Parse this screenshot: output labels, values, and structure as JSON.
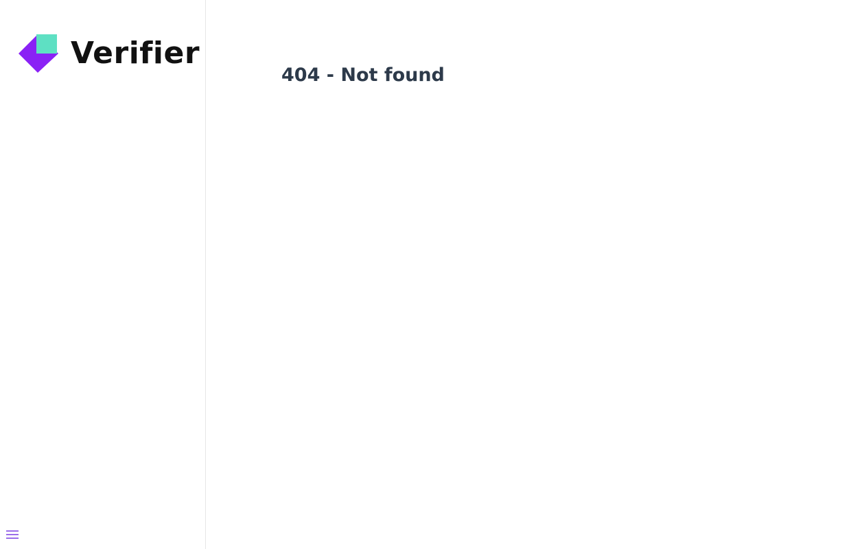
{
  "sidebar": {
    "logo": {
      "text": "Verifier",
      "colors": {
        "primary": "#8a22f5",
        "accent": "#5ee0c3"
      }
    },
    "menu_icon": "hamburger-menu-icon",
    "menu_icon_color": "#7b3fe4"
  },
  "main": {
    "title": "404 - Not found"
  }
}
